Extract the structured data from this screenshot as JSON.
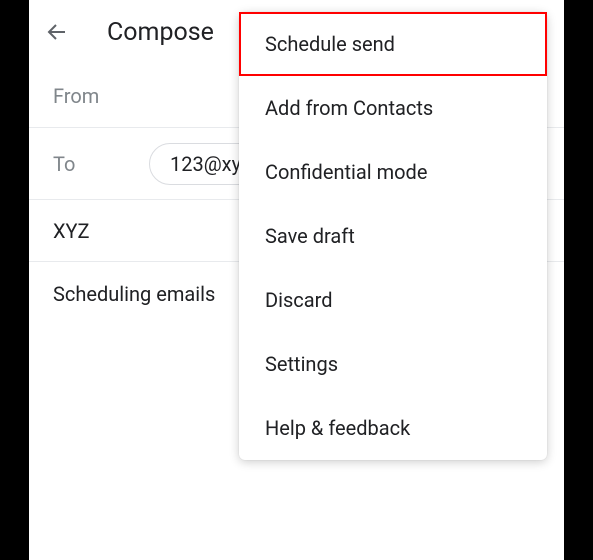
{
  "header": {
    "title": "Compose"
  },
  "fields": {
    "from_label": "From",
    "to_label": "To",
    "to_value": "123@xy",
    "subject": "XYZ"
  },
  "body": "Scheduling emails",
  "menu": {
    "items": [
      {
        "label": "Schedule send",
        "highlighted": true
      },
      {
        "label": "Add from Contacts",
        "highlighted": false
      },
      {
        "label": "Confidential mode",
        "highlighted": false
      },
      {
        "label": "Save draft",
        "highlighted": false
      },
      {
        "label": "Discard",
        "highlighted": false
      },
      {
        "label": "Settings",
        "highlighted": false
      },
      {
        "label": "Help & feedback",
        "highlighted": false
      }
    ]
  }
}
